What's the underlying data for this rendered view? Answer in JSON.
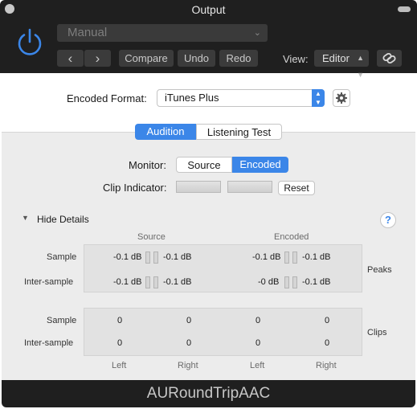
{
  "window": {
    "title": "Output"
  },
  "header": {
    "preset": "Manual",
    "nav_back": "‹",
    "nav_forward": "›",
    "compare": "Compare",
    "undo": "Undo",
    "redo": "Redo",
    "view_label": "View:",
    "view_value": "Editor"
  },
  "format": {
    "label": "Encoded Format:",
    "value": "iTunes Plus"
  },
  "tabs": {
    "audition": "Audition",
    "listening_test": "Listening Test",
    "active": "Audition"
  },
  "monitor": {
    "label": "Monitor:",
    "source": "Source",
    "encoded": "Encoded",
    "selected": "Encoded"
  },
  "clip": {
    "label": "Clip Indicator:",
    "reset": "Reset"
  },
  "details": {
    "toggle": "Hide Details",
    "help": "?",
    "source_header": "Source",
    "encoded_header": "Encoded",
    "peaks": {
      "group_label": "Peaks",
      "sample_label": "Sample",
      "inter_label": "Inter-sample",
      "sample": {
        "source_left": "-0.1 dB",
        "source_right": "-0.1 dB",
        "encoded_left": "-0.1 dB",
        "encoded_right": "-0.1 dB"
      },
      "inter": {
        "source_left": "-0.1 dB",
        "source_right": "-0.1 dB",
        "encoded_left": "-0 dB",
        "encoded_right": "-0.1 dB"
      }
    },
    "clips": {
      "group_label": "Clips",
      "sample_label": "Sample",
      "inter_label": "Inter-sample",
      "sample": {
        "source_left": "0",
        "source_right": "0",
        "encoded_left": "0",
        "encoded_right": "0"
      },
      "inter": {
        "source_left": "0",
        "source_right": "0",
        "encoded_left": "0",
        "encoded_right": "0"
      }
    },
    "columns": {
      "left1": "Left",
      "right1": "Right",
      "left2": "Left",
      "right2": "Right"
    }
  },
  "footer": {
    "plugin_name": "AURoundTripAAC"
  },
  "colors": {
    "accent": "#3b86e8",
    "header_bg": "#1f1f1f",
    "panel_bg": "#ececec"
  }
}
